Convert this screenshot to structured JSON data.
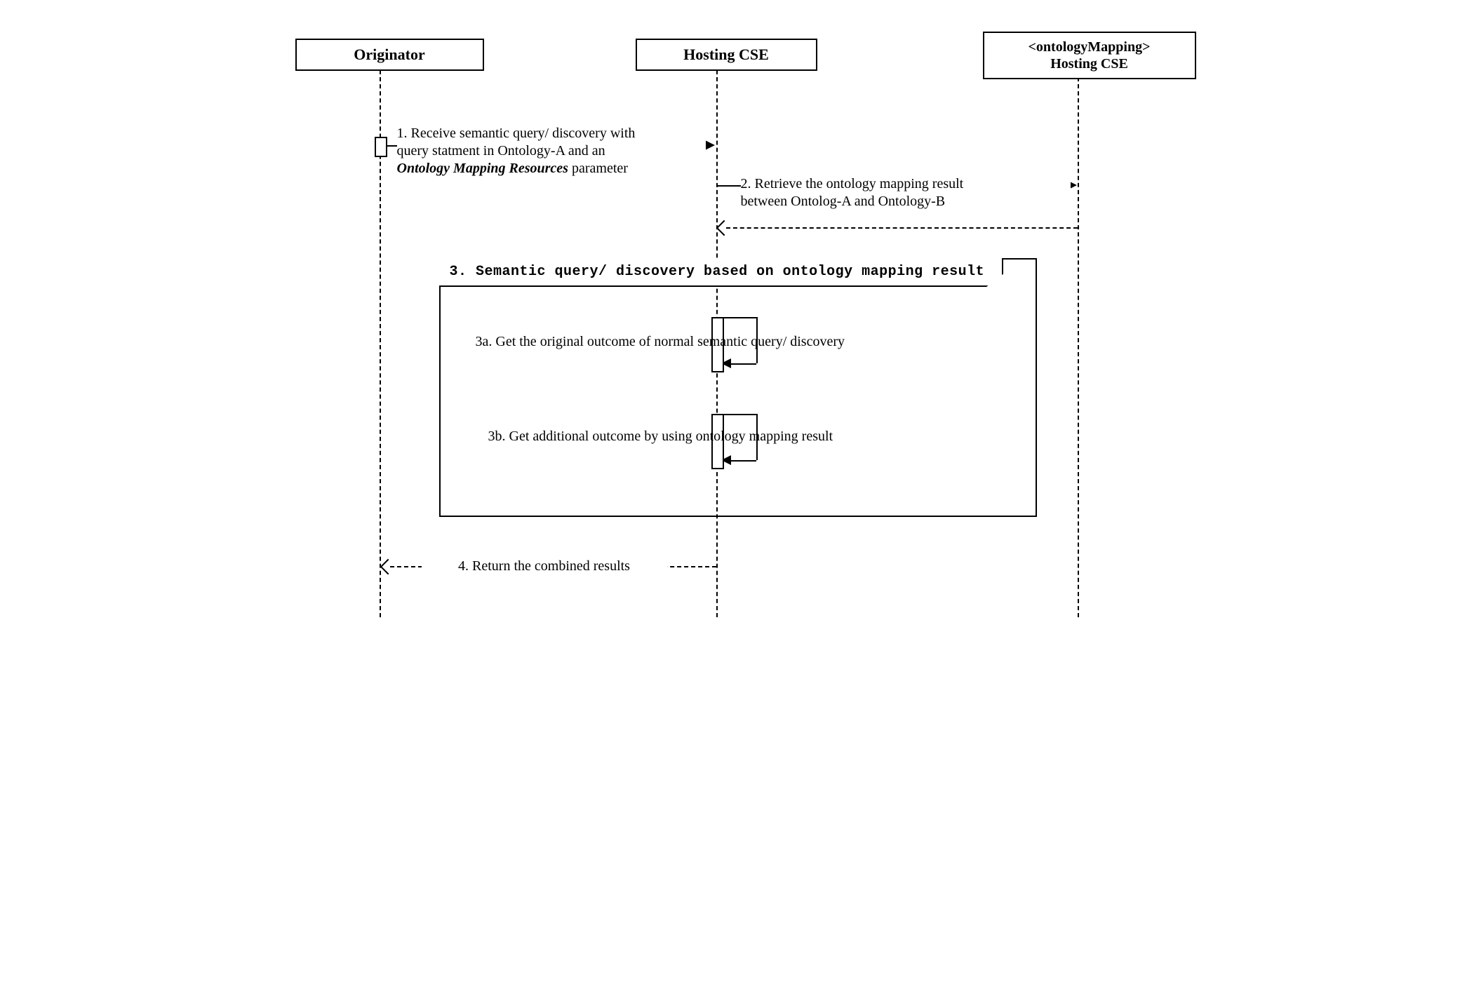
{
  "actors": {
    "originator": "Originator",
    "hosting_cse": "Hosting CSE",
    "ontology_mapping_line1": "<ontologyMapping>",
    "ontology_mapping_line2": "Hosting CSE"
  },
  "messages": {
    "msg1_line1": "1. Receive semantic query/ discovery with",
    "msg1_line2": "query statment in Ontology-A and an",
    "msg1_italic": "Ontology Mapping Resources",
    "msg1_line3_rest": " parameter",
    "msg2_line1": "2. Retrieve the ontology mapping result",
    "msg2_line2": "between Ontolog-A and Ontology-B",
    "msg3a": "3a. Get the original outcome of normal semantic query/ discovery",
    "msg3b": "3b. Get additional outcome by using ontology mapping result",
    "msg4": "4. Return the combined results"
  },
  "fragment": {
    "label": "3. Semantic query/ discovery based on ontology mapping result"
  }
}
